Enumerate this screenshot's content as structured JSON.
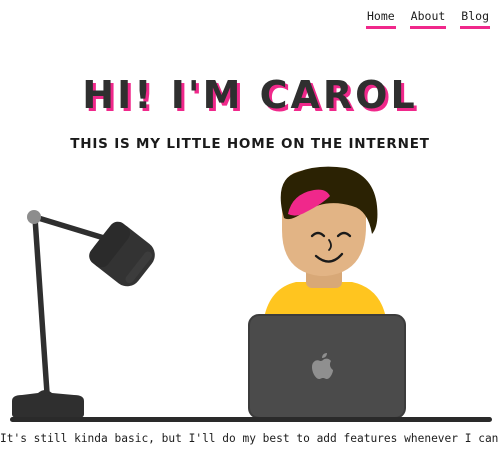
{
  "nav": {
    "items": [
      {
        "label": "Home"
      },
      {
        "label": "About"
      },
      {
        "label": "Blog"
      }
    ]
  },
  "hero": {
    "title": "Hi! I'm Carol",
    "subtitle": "This is my little home on the internet"
  },
  "footer": {
    "text": "It's still kinda basic, but I'll do my best to add features whenever I can"
  },
  "colors": {
    "accent": "#f0288b",
    "text": "#2f2f2f",
    "shirt": "#ffc51f",
    "skin": "#e2b485",
    "hair": "#2b2203",
    "laptop": "#4b4b4b",
    "lamp": "#2f2f2f"
  },
  "icons": {
    "footer_emoji": "smiling-face-emoji",
    "laptop_logo": "apple-logo-icon"
  }
}
